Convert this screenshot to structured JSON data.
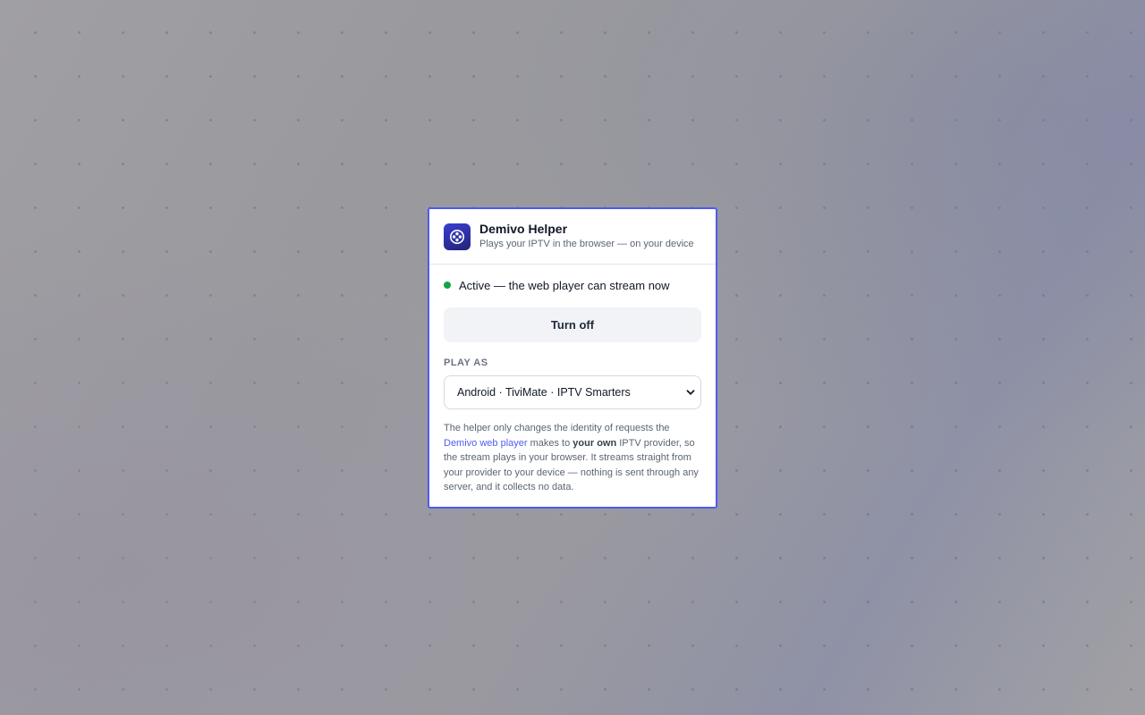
{
  "app": {
    "title": "Demivo Helper",
    "subtitle": "Plays your IPTV in the browser — on your device",
    "icon": "film-reel-icon",
    "accent_color": "#4f5bf2"
  },
  "status": {
    "state": "active",
    "text": "Active — the web player can stream now",
    "dot_color": "#16a34a"
  },
  "toggle": {
    "label": "Turn off"
  },
  "play_as": {
    "label": "PLAY AS",
    "selected": "Android · TiviMate · IPTV Smarters"
  },
  "note": {
    "part1": "The helper only changes the identity of requests the ",
    "link_text": "Demivo web player",
    "part2": " makes to ",
    "emphasis": "your own",
    "part3": " IPTV provider, so the stream plays in your browser. It streams straight from your provider to your device — nothing is sent through any server, and it collects no data."
  }
}
